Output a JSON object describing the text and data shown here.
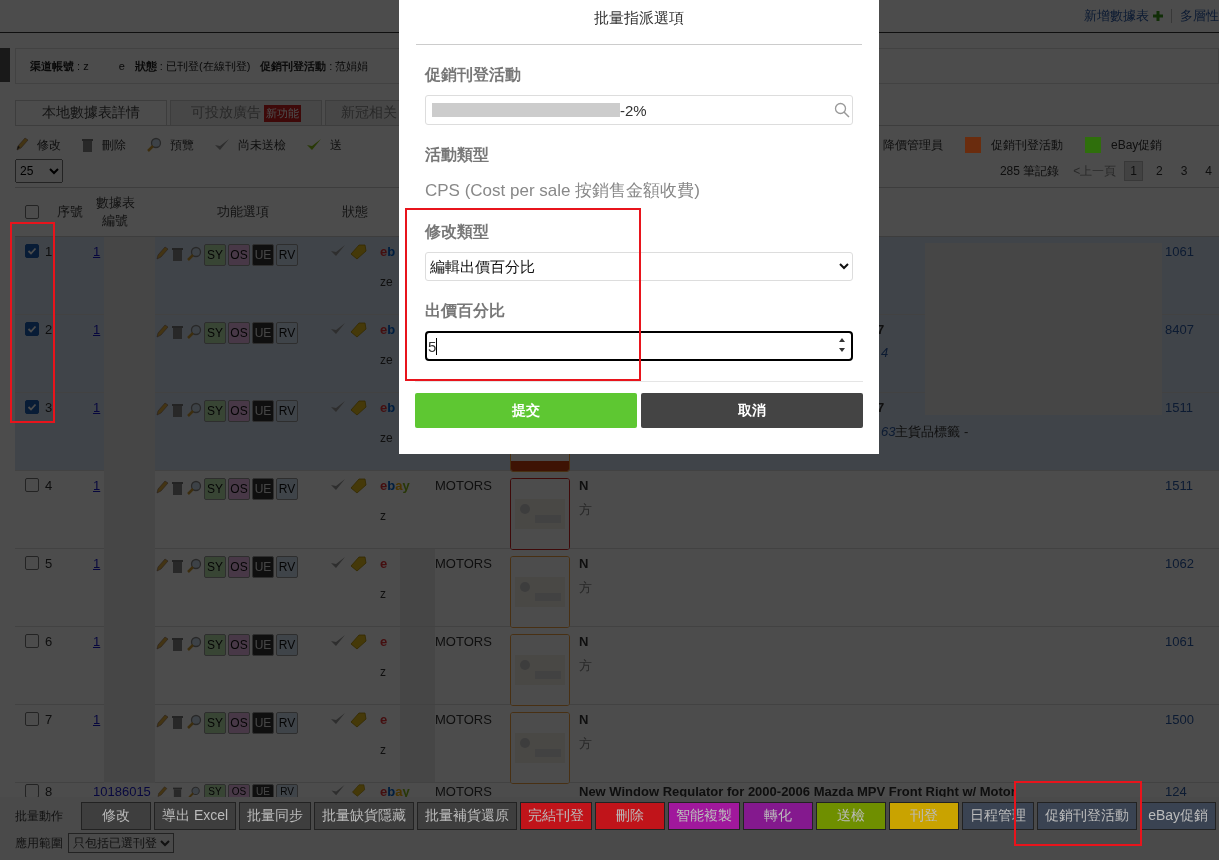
{
  "header": {
    "links": [
      {
        "kind": "add",
        "text": "新增數據表"
      },
      {
        "kind": "plain",
        "text": "多層性"
      }
    ]
  },
  "info_bar": [
    {
      "text": "**渠道帳號** : z",
      "text_end": "e"
    },
    {
      "text": "**狀態** : 已刊登(在線刊登)"
    },
    {
      "text": "**促銷刊登活動** : 范娟娟"
    }
  ],
  "tabs": [
    {
      "label": "本地數據表詳情",
      "selected": true
    },
    {
      "label": "可投放廣告",
      "badge": "新功能",
      "selected": false
    },
    {
      "label": "新冠相关",
      "selected": false
    }
  ],
  "toolbar": [
    {
      "kind": "edit",
      "label": "修改"
    },
    {
      "kind": "delete",
      "label": "刪除"
    },
    {
      "kind": "preview",
      "label": "預覽"
    },
    {
      "kind": "unchecked",
      "label": "尚未送檢"
    },
    {
      "kind": "checked",
      "label": "送"
    }
  ],
  "legend": [
    {
      "label": "降價管理員"
    },
    {
      "label": "促銷刊登活動",
      "color": "#6a2c0e"
    },
    {
      "label": "eBay促銷",
      "color": "#2f6f0c"
    }
  ],
  "page_size": "25",
  "records": "285 筆記錄",
  "pager": {
    "prev": {
      "label": "<上一頁",
      "disabled": true
    },
    "pages": [
      {
        "label": "1",
        "selected": true
      },
      {
        "label": "2",
        "selected": false
      },
      {
        "label": "3",
        "selected": false
      },
      {
        "label": "4",
        "selected": false
      }
    ]
  },
  "select_all": {
    "checked": false
  },
  "columns": [
    "序號",
    "數據表編號",
    "功能選項",
    "狀態"
  ],
  "rows": [
    {
      "kind": "covered",
      "selected": true,
      "number": "1",
      "id": "1",
      "actions": [
        "SY",
        "OS",
        "UE",
        "RV"
      ],
      "logo": "eb",
      "sub": "ze",
      "price": "1061"
    },
    {
      "kind": "covered",
      "selected": true,
      "number": "2",
      "id": "1",
      "actions": [
        "SY",
        "OS",
        "UE",
        "RV"
      ],
      "logo": "eb",
      "sub": "ze",
      "title": "7",
      "note_num": "4",
      "price": "8407"
    },
    {
      "kind": "covered",
      "selected": true,
      "number": "3",
      "id": "1",
      "actions": [
        "SY",
        "OS",
        "UE",
        "RV"
      ],
      "logo": "eb",
      "sub": "ze",
      "image": {
        "kind": "picture"
      },
      "title": "7",
      "note_num": "63",
      "note": "主貨品標籤 -",
      "price": "1511"
    },
    {
      "kind": "plain",
      "selected": false,
      "number": "4",
      "id": "1",
      "actions": [
        "SY",
        "OS",
        "UE",
        "RV"
      ],
      "logo": "ebay",
      "sub": "z",
      "platform": "MOTORS",
      "image": {
        "kind": "picture"
      },
      "title": "N",
      "subtitle": "方",
      "price": "1511"
    },
    {
      "kind": "plain",
      "selected": false,
      "number": "5",
      "id": "1",
      "actions": [
        "SY",
        "OS",
        "UE",
        "RV"
      ],
      "logo": "e",
      "sub": "z",
      "platform": "MOTORS",
      "image": {
        "kind": "picture"
      },
      "title": "N",
      "subtitle": "方",
      "price": "1062"
    },
    {
      "kind": "plain",
      "selected": false,
      "number": "6",
      "id": "1",
      "actions": [
        "SY",
        "OS",
        "UE",
        "RV"
      ],
      "logo": "e",
      "sub": "z",
      "platform": "MOTORS",
      "image": {
        "kind": "picture"
      },
      "title": "N",
      "subtitle": "方",
      "price": "1061"
    },
    {
      "kind": "plain",
      "selected": false,
      "number": "7",
      "id": "1",
      "actions": [
        "SY",
        "OS",
        "UE",
        "RV"
      ],
      "logo": "e",
      "sub": "z",
      "platform": "MOTORS",
      "image": {
        "kind": "picture"
      },
      "title": "N",
      "subtitle": "方",
      "price": "1500"
    },
    {
      "kind": "full",
      "selected": false,
      "number": "8",
      "id": "10186015",
      "actions": [
        "SY",
        "OS",
        "UE",
        "RV"
      ],
      "logo": "ebay",
      "platform": "MOTORS",
      "title": "New Window Regulator for 2000-2006 Mazda MPV Front Right w/ Motor",
      "price": "124"
    }
  ],
  "modal": {
    "title": "批量指派選項",
    "campaign": {
      "label": "促銷刊登活動",
      "value": "-2%"
    },
    "activity_type": {
      "label": "活動類型",
      "value": "CPS (Cost per sale 按銷售金額收費)"
    },
    "edit_type": {
      "label": "修改類型",
      "value": "編輯出價百分比"
    },
    "bid_percent": {
      "label": "出價百分比",
      "value": "5"
    },
    "buttons": [
      {
        "kind": "submit",
        "label": "提交"
      },
      {
        "kind": "cancel",
        "label": "取消"
      }
    ]
  },
  "bulk_bar": {
    "label": "批量動作",
    "buttons": [
      {
        "label": "修改",
        "color": "#3e3e3e"
      },
      {
        "label": "導出 Excel",
        "color": "#3e3e3e"
      },
      {
        "label": "批量同步",
        "color": "#3e3e3e"
      },
      {
        "label": "批量缺貨隱藏",
        "color": "#3e3e3e"
      },
      {
        "label": "批量補貨還原",
        "color": "#3e3e3e"
      },
      {
        "label": "完結刊登",
        "color": "#c0141a"
      },
      {
        "label": "刪除",
        "color": "#c0141a"
      },
      {
        "label": "智能複製",
        "color": "#a0189c"
      },
      {
        "label": "轉化",
        "color": "#84198e"
      },
      {
        "label": "送檢",
        "color": "#6f8f00"
      },
      {
        "label": "刊登",
        "color": "#c9a300"
      },
      {
        "label": "日程管理",
        "color": "#3a4352"
      },
      {
        "label": "促銷刊登活動",
        "color": "#3a4352"
      },
      {
        "label": "eBay促銷",
        "color": "#3a4352"
      }
    ],
    "scope_label": "應用範圍",
    "scope_value": "只包括已選刊登"
  }
}
